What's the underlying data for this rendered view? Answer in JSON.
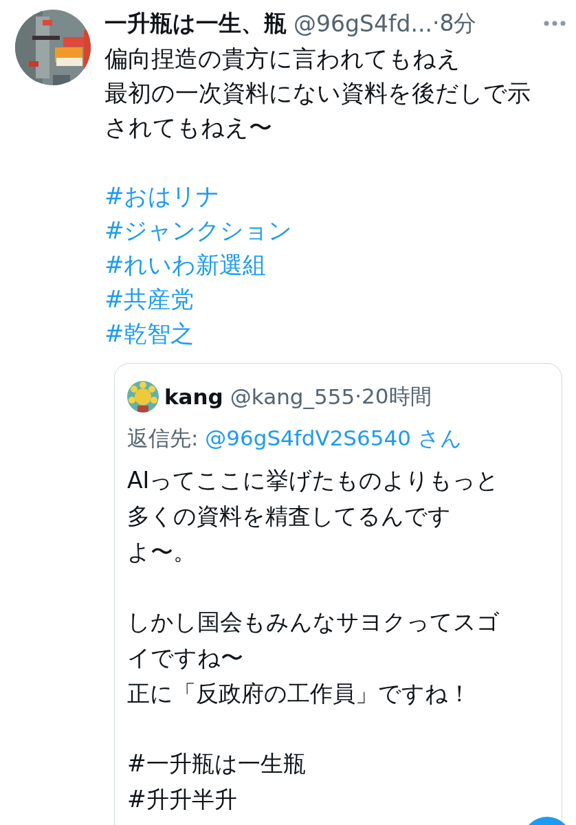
{
  "tweet": {
    "name": "一升瓶は一生、瓶",
    "handle": "@96gS4fd...",
    "time": "·8分",
    "text_lines": [
      "偏向捏造の貴方に言われてもねえ",
      "最初の一次資料にない資料を後だしで示",
      "されてもねえ〜"
    ],
    "hashtags": [
      "#おはリナ",
      "#ジャンクション",
      "#れいわ新選組",
      "#共産党",
      "#乾智之"
    ],
    "quote": {
      "name": "kang",
      "handle": "@kang_555",
      "time": "·20時間",
      "reply_label": "返信先:",
      "reply_to": "@96gS4fdV2S6540 さん",
      "paragraphs": [
        [
          "AIってここに挙げたものよりもっと",
          "多くの資料を精査してるんです",
          "よ〜。"
        ],
        [
          "しかし国会もみんなサヨクってスゴ",
          "イですね〜",
          "正に「反政府の工作員」ですね！"
        ]
      ],
      "hashtags": [
        "#一升瓶は一生瓶",
        "#升升半升"
      ]
    }
  }
}
